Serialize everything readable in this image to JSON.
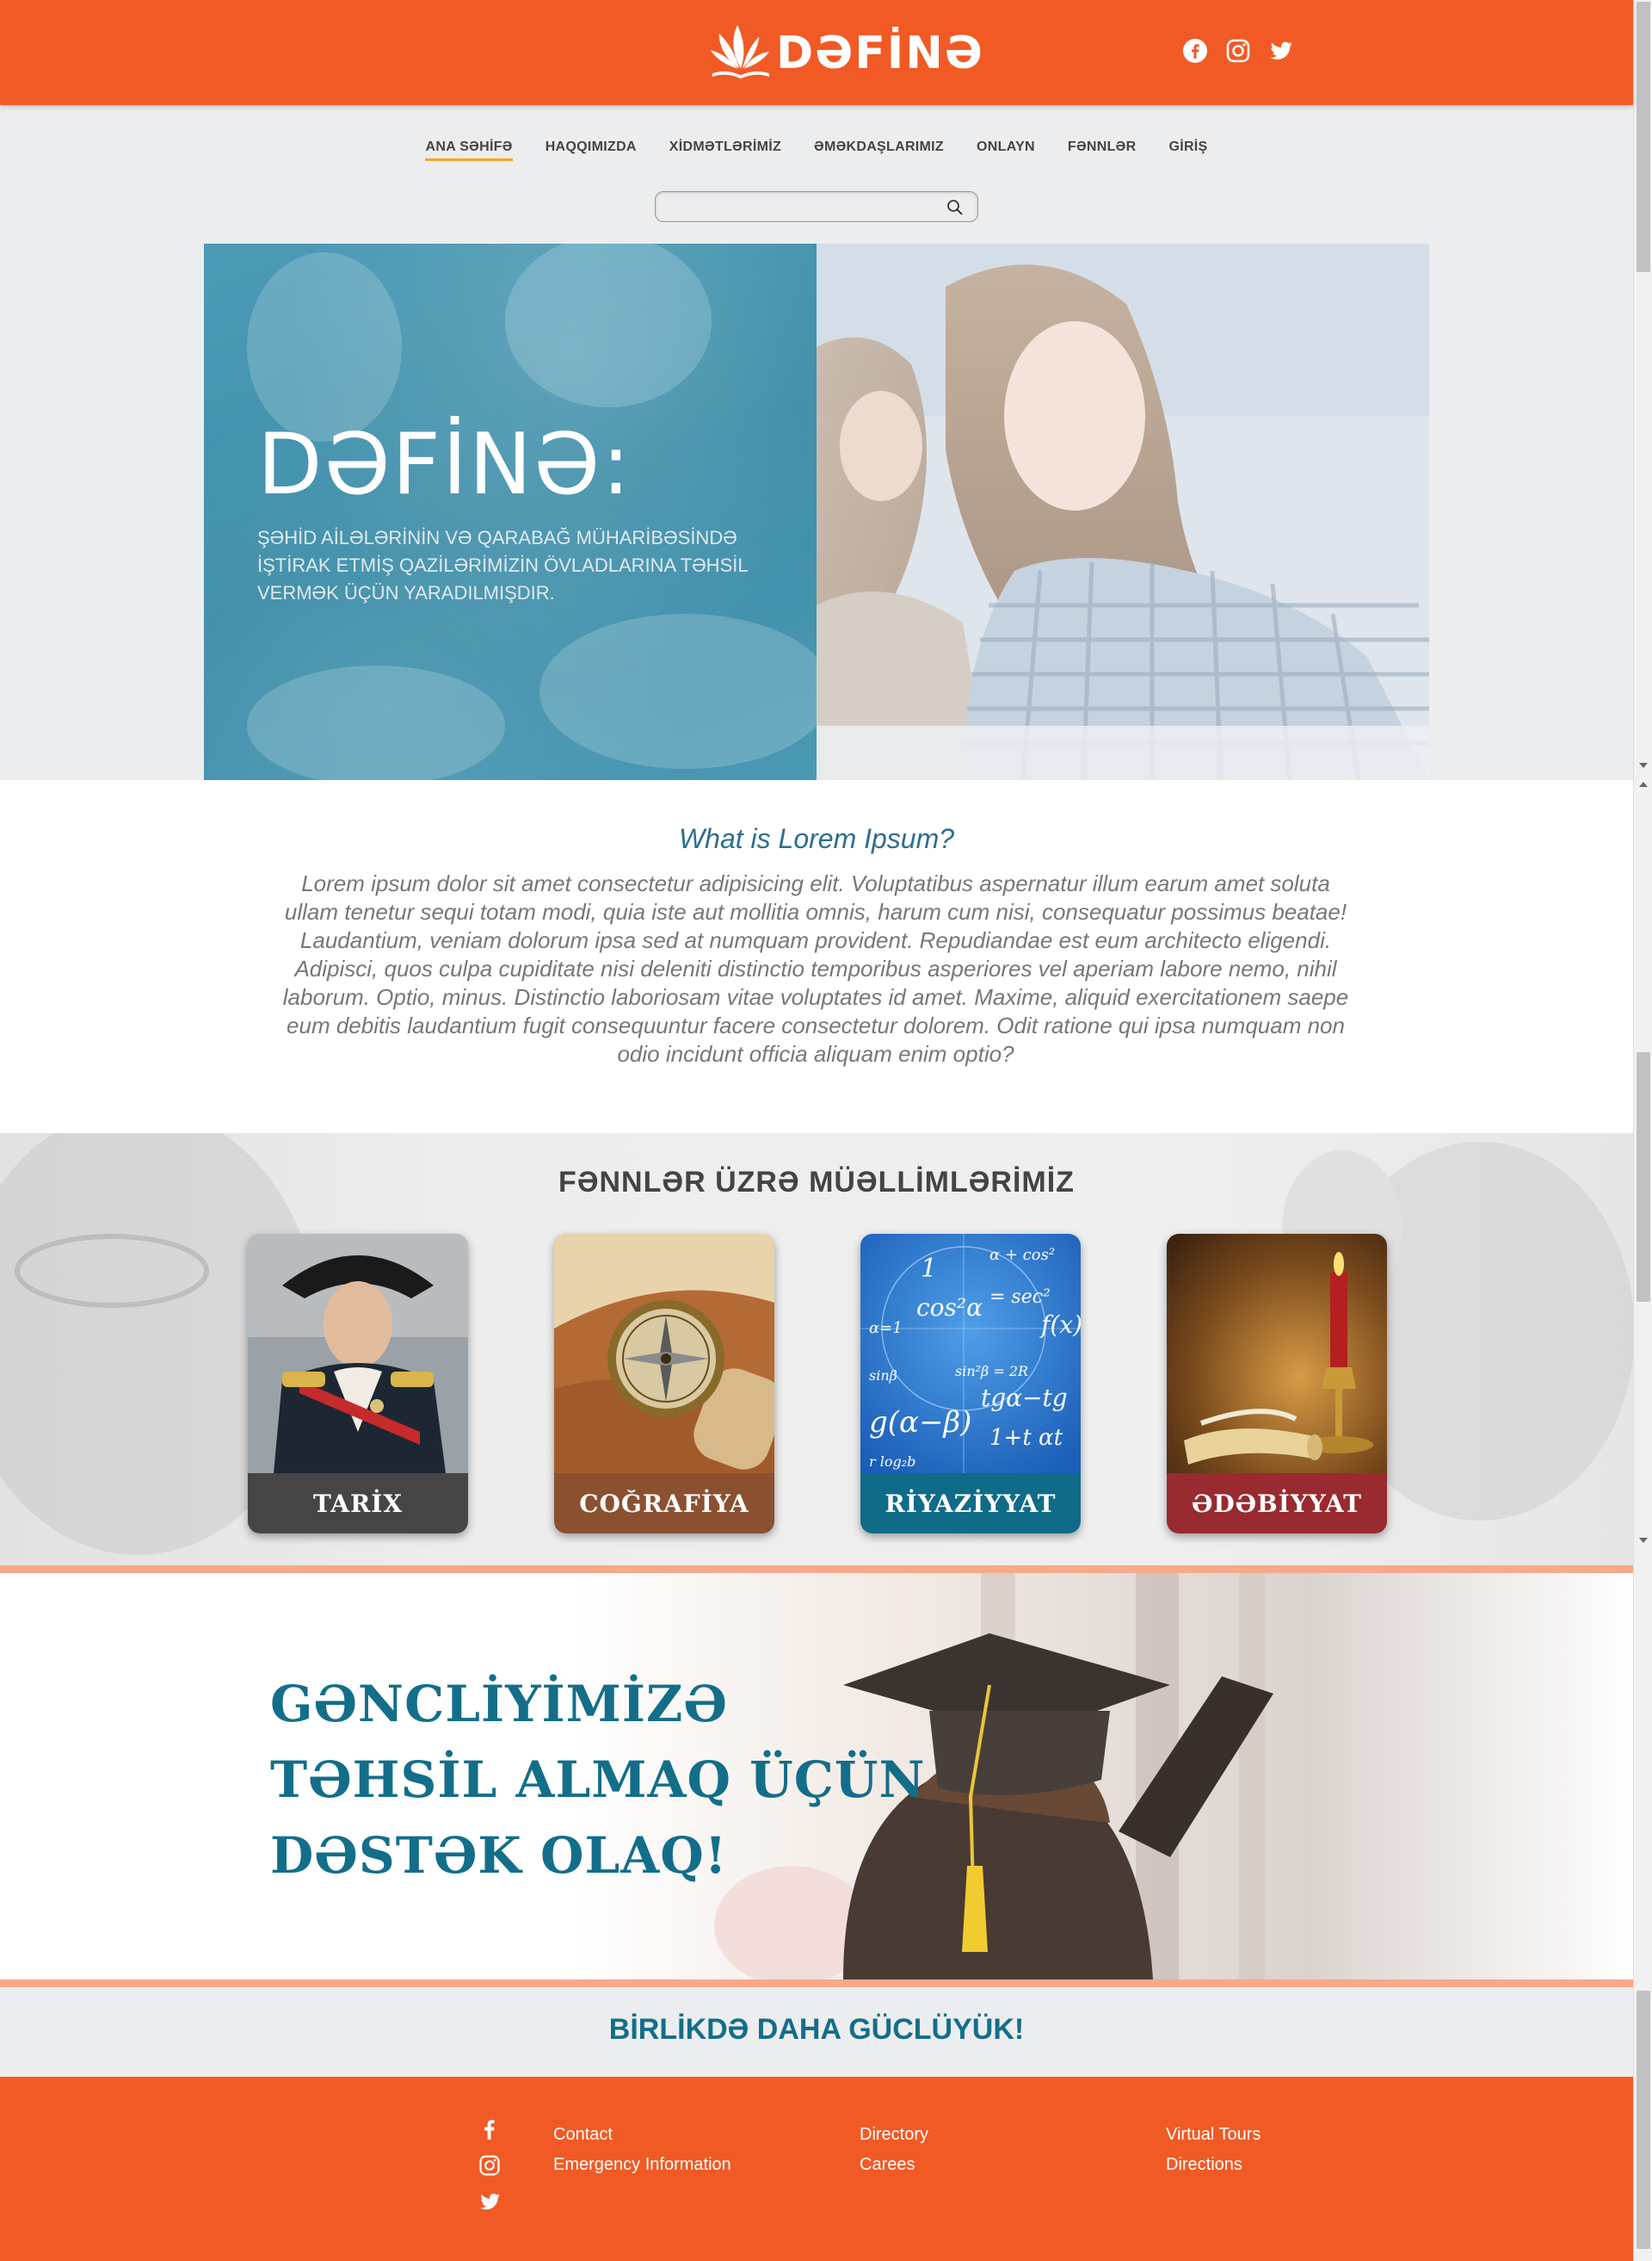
{
  "header": {
    "logo_text": "DƏFİNƏ"
  },
  "nav": {
    "items": [
      {
        "label": "ANA SƏHİFƏ",
        "active": true
      },
      {
        "label": "HAQQIMIZDA",
        "active": false
      },
      {
        "label": "XİDMƏTLƏRİMİZ",
        "active": false
      },
      {
        "label": "ƏMƏKDAŞLARIMIZ",
        "active": false
      },
      {
        "label": "ONLAYN",
        "active": false
      },
      {
        "label": "FƏNNLƏR",
        "active": false
      },
      {
        "label": "GİRİŞ",
        "active": false
      }
    ],
    "search_placeholder": ""
  },
  "hero": {
    "title": "DƏFİNƏ:",
    "subtitle": "ŞƏHİD AİLƏLƏRİNİN VƏ QARABAĞ MÜHARİBƏSİNDƏ İŞTİRAK ETMİŞ QAZİLƏRİMİZİN ÖVLADLARINA TƏHSİL VERMƏK ÜÇÜN YARADILMIŞDIR."
  },
  "intro": {
    "title": "What is Lorem Ipsum?",
    "text": "Lorem ipsum dolor sit amet consectetur adipisicing elit. Voluptatibus aspernatur illum earum amet soluta ullam tenetur sequi totam modi, quia iste aut mollitia omnis, harum cum nisi, consequatur possimus beatae! Laudantium, veniam dolorum ipsa sed at numquam provident. Repudiandae est eum architecto eligendi. Adipisci, quos culpa cupiditate nisi deleniti distinctio temporibus asperiores vel aperiam labore nemo, nihil laborum. Optio, minus. Distinctio laboriosam vitae voluptates id amet. Maxime, aliquid exercitationem saepe eum debitis laudantium fugit consequuntur facere consectetur dolorem. Odit ratione qui ipsa numquam non odio incidunt officia aliquam enim optio?"
  },
  "teachers": {
    "title": "FƏNNLƏR ÜZRƏ MÜƏLLİMLƏRİMİZ",
    "cards": [
      {
        "label": "TARİX",
        "color": "#454545"
      },
      {
        "label": "COĞRAFİYA",
        "color": "#8a5030"
      },
      {
        "label": "RİYAZİYYAT",
        "color": "#0f6b88"
      },
      {
        "label": "ƏDƏBİYYAT",
        "color": "#992a2f"
      }
    ]
  },
  "banner": {
    "line1": "GƏNCLİYİMİZƏ",
    "line2": "TƏHSİL ALMAQ ÜÇÜN",
    "line3": "DƏSTƏK OLAQ!"
  },
  "slogan": {
    "text": "BİRLİKDƏ DAHA GÜCLÜYÜK!"
  },
  "footer": {
    "col1": [
      "Contact",
      "Emergency Information"
    ],
    "col2": [
      "Directory",
      "Carees"
    ],
    "col3": [
      "Virtual Tours",
      "Directions"
    ]
  },
  "colors": {
    "brand_orange": "#f15a24",
    "accent_teal": "#136e8a",
    "nav_underline": "#f5a623"
  }
}
